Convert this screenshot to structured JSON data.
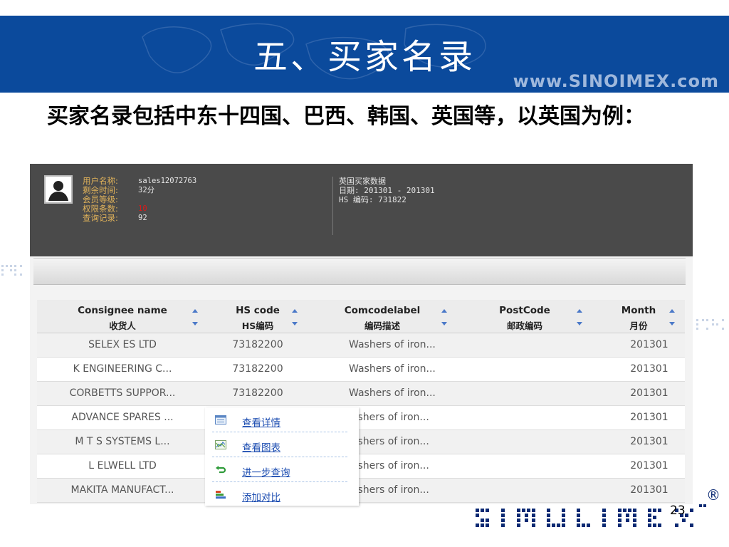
{
  "slide": {
    "title": "五、买家名录",
    "url": "www.SINOIMEX.com",
    "intro": "买家名录包括中东十四国、巴西、韩国、英国等，以英国为例：",
    "page_number": "23",
    "registered_mark": "®"
  },
  "user_info": {
    "rows": [
      {
        "label": "用户名称:",
        "value": "sales12072763"
      },
      {
        "label": "剩余时间:",
        "value": "32分"
      },
      {
        "label": "会员等级:",
        "value": ""
      },
      {
        "label": "权限条数:",
        "value": "10"
      },
      {
        "label": "查询记录:",
        "value": "92"
      }
    ]
  },
  "data_info": {
    "title": "英国买家数据",
    "date": "日期: 201301 - 201301",
    "hs": "HS 编码: 731822"
  },
  "table": {
    "columns": [
      {
        "en": "Consignee name",
        "zh": "收货人"
      },
      {
        "en": "HS code",
        "zh": "HS编码"
      },
      {
        "en": "Comcodelabel",
        "zh": "编码描述"
      },
      {
        "en": "PostCode",
        "zh": "邮政编码"
      },
      {
        "en": "Month",
        "zh": "月份"
      }
    ],
    "rows": [
      [
        "SELEX ES LTD",
        "73182200",
        "Washers of iron...",
        "",
        "201301"
      ],
      [
        "K ENGINEERING C...",
        "73182200",
        "Washers of iron...",
        "",
        "201301"
      ],
      [
        "CORBETTS SUPPOR...",
        "73182200",
        "Washers of iron...",
        "",
        "201301"
      ],
      [
        "ADVANCE SPARES ...",
        "",
        "'ashers of iron...",
        "",
        "201301"
      ],
      [
        "M T S SYSTEMS L...",
        "",
        "'ashers of iron...",
        "",
        "201301"
      ],
      [
        "L ELWELL LTD",
        "",
        "'ashers of iron...",
        "",
        "201301"
      ],
      [
        "MAKITA MANUFACT...",
        "",
        "'ashers of iron...",
        "",
        "201301"
      ]
    ]
  },
  "context_menu": {
    "items": [
      {
        "label": "查看详情",
        "icon": "details-icon"
      },
      {
        "label": "查看图表",
        "icon": "chart-icon"
      },
      {
        "label": "进一步查询",
        "icon": "refine-search-icon"
      },
      {
        "label": "添加对比",
        "icon": "compare-icon"
      }
    ]
  },
  "colors": {
    "header_blue": "#0b4a9c",
    "panel_dark": "#4a4a4a",
    "label_gold": "#e0b25a",
    "link_blue": "#1f4fb2",
    "alert_red": "#d41b1b"
  }
}
